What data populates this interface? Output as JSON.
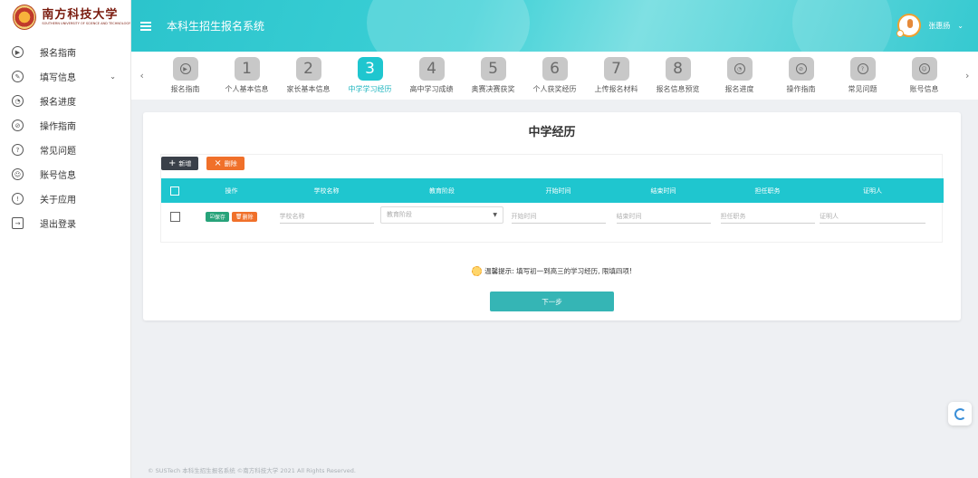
{
  "logo": {
    "name_cn": "南方科技大学",
    "name_en": "SOUTHERN UNIVERSITY OF SCIENCE AND TECHNOLOGY"
  },
  "header": {
    "title": "本科生招生报名系统",
    "user_name": "张惠扬"
  },
  "sidebar": {
    "items": [
      {
        "label": "报名指南",
        "icon": "play-circle-icon"
      },
      {
        "label": "填写信息",
        "icon": "edit-circle-icon",
        "has_submenu": true
      },
      {
        "label": "报名进度",
        "icon": "gauge-icon"
      },
      {
        "label": "操作指南",
        "icon": "compass-icon"
      },
      {
        "label": "常见问题",
        "icon": "question-circle-icon"
      },
      {
        "label": "账号信息",
        "icon": "user-circle-icon"
      },
      {
        "label": "关于应用",
        "icon": "info-circle-icon"
      },
      {
        "label": "退出登录",
        "icon": "logout-icon"
      }
    ]
  },
  "steps": [
    {
      "label": "报名指南",
      "num": "",
      "icon": "play-circle-icon"
    },
    {
      "label": "个人基本信息",
      "num": "1"
    },
    {
      "label": "家长基本信息",
      "num": "2"
    },
    {
      "label": "中学学习经历",
      "num": "3",
      "active": true
    },
    {
      "label": "高中学习成绩",
      "num": "4"
    },
    {
      "label": "奥赛决赛获奖",
      "num": "5"
    },
    {
      "label": "个人获奖经历",
      "num": "6"
    },
    {
      "label": "上传报名材料",
      "num": "7"
    },
    {
      "label": "报名信息预览",
      "num": "8"
    },
    {
      "label": "报名进度",
      "num": "",
      "icon": "gauge-icon"
    },
    {
      "label": "操作指南",
      "num": "",
      "icon": "compass-icon"
    },
    {
      "label": "常见问题",
      "num": "",
      "icon": "question-circle-icon"
    },
    {
      "label": "账号信息",
      "num": "",
      "icon": "user-circle-icon"
    }
  ],
  "main": {
    "title": "中学经历",
    "add_label": "新增",
    "delete_label": "删除",
    "columns": [
      "操作",
      "学校名称",
      "教育阶段",
      "开始时间",
      "结束时间",
      "担任职务",
      "证明人"
    ],
    "row": {
      "save_label": "保存",
      "delete_label": "删除",
      "school_placeholder": "学校名称",
      "stage_placeholder": "教育阶段",
      "start_placeholder": "开始时间",
      "end_placeholder": "结束时间",
      "position_placeholder": "担任职务",
      "witness_placeholder": "证明人"
    },
    "tip": "温馨提示: 填写初一到高三的学习经历, 限填四项!",
    "next_label": "下一步"
  },
  "footer": {
    "text": "© SUSTech 本科生招生报名系统 ©南方科技大学 2021 All Rights Reserved."
  },
  "colors": {
    "accent": "#1fc6cf",
    "add_button": "#3a4049",
    "delete_button": "#f0702a",
    "save_button": "#27a37a",
    "next_button": "#35b5b5"
  }
}
